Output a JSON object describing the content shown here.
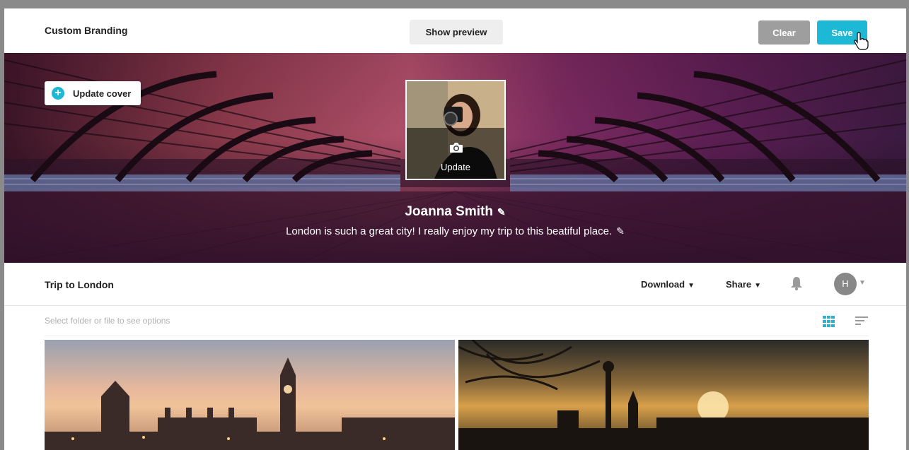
{
  "topbar": {
    "title": "Custom Branding",
    "preview_label": "Show preview",
    "clear_label": "Clear",
    "save_label": "Save"
  },
  "cover": {
    "update_cover_label": "Update cover",
    "avatar_update_label": "Update",
    "name": "Joanna Smith",
    "bio": "London is such a great city! I really enjoy my trip to this beatiful place."
  },
  "folder": {
    "title": "Trip to London",
    "download_label": "Download",
    "share_label": "Share",
    "user_initial": "H",
    "options_hint": "Select folder or file to see options"
  },
  "colors": {
    "accent": "#1db8d6",
    "clear_button": "#9e9e9e"
  },
  "icons": [
    "plus-circle-icon",
    "camera-icon",
    "pencil-icon",
    "caret-down-icon",
    "bell-icon",
    "grid-view-icon",
    "sort-icon",
    "hand-cursor-icon"
  ]
}
